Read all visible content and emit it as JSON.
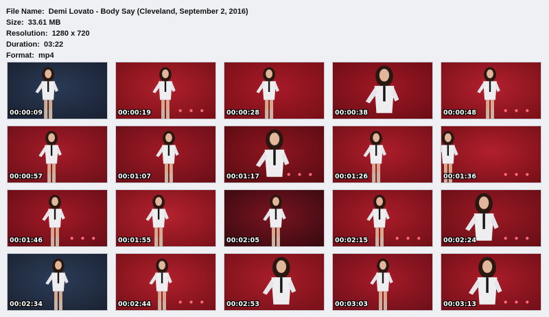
{
  "info": {
    "file_name_label": "File Name:",
    "file_name": "Demi Lovato - Body Say (Cleveland, September 2, 2016)",
    "size_label": "Size:",
    "size": "33.61 MB",
    "resolution_label": "Resolution:",
    "resolution": "1280 x 720",
    "duration_label": "Duration:",
    "duration": "03:22",
    "format_label": "Format:",
    "format": "mp4"
  },
  "thumbnails": [
    {
      "time": "00:00:09",
      "bg": "#1a2233",
      "glow": "#2a3a55",
      "pose": "stand"
    },
    {
      "time": "00:00:19",
      "bg": "#7a1018",
      "glow": "#b0202c",
      "pose": "stand"
    },
    {
      "time": "00:00:28",
      "bg": "#7a1018",
      "glow": "#a81a28",
      "pose": "stand"
    },
    {
      "time": "00:00:38",
      "bg": "#6e0e16",
      "glow": "#a01824",
      "pose": "close"
    },
    {
      "time": "00:00:48",
      "bg": "#7c1119",
      "glow": "#b3202e",
      "pose": "stand"
    },
    {
      "time": "00:00:57",
      "bg": "#70111a",
      "glow": "#a51b28",
      "pose": "stand"
    },
    {
      "time": "00:01:07",
      "bg": "#6c0f18",
      "glow": "#a01a26",
      "pose": "stand"
    },
    {
      "time": "00:01:17",
      "bg": "#5c0c12",
      "glow": "#8f1520",
      "pose": "close"
    },
    {
      "time": "00:01:26",
      "bg": "#76111a",
      "glow": "#ad1d2a",
      "pose": "stand"
    },
    {
      "time": "00:01:36",
      "bg": "#781019",
      "glow": "#b21f2c",
      "pose": "edge"
    },
    {
      "time": "00:01:46",
      "bg": "#6a0e17",
      "glow": "#a21a27",
      "pose": "stand"
    },
    {
      "time": "00:01:55",
      "bg": "#7e121b",
      "glow": "#b5222f",
      "pose": "stand"
    },
    {
      "time": "00:02:05",
      "bg": "#3a0a10",
      "glow": "#7a1420",
      "pose": "stand"
    },
    {
      "time": "00:02:15",
      "bg": "#741019",
      "glow": "#ab1c29",
      "pose": "stand"
    },
    {
      "time": "00:02:24",
      "bg": "#6a0f17",
      "glow": "#9c1924",
      "pose": "close"
    },
    {
      "time": "00:02:34",
      "bg": "#1c2434",
      "glow": "#2b3c58",
      "pose": "stand"
    },
    {
      "time": "00:02:44",
      "bg": "#7a1119",
      "glow": "#b0202d",
      "pose": "stand"
    },
    {
      "time": "00:02:53",
      "bg": "#7a1119",
      "glow": "#a81d2a",
      "pose": "close"
    },
    {
      "time": "00:03:03",
      "bg": "#70101a",
      "glow": "#a61b28",
      "pose": "stand"
    },
    {
      "time": "00:03:13",
      "bg": "#741019",
      "glow": "#ab1c29",
      "pose": "close"
    }
  ]
}
